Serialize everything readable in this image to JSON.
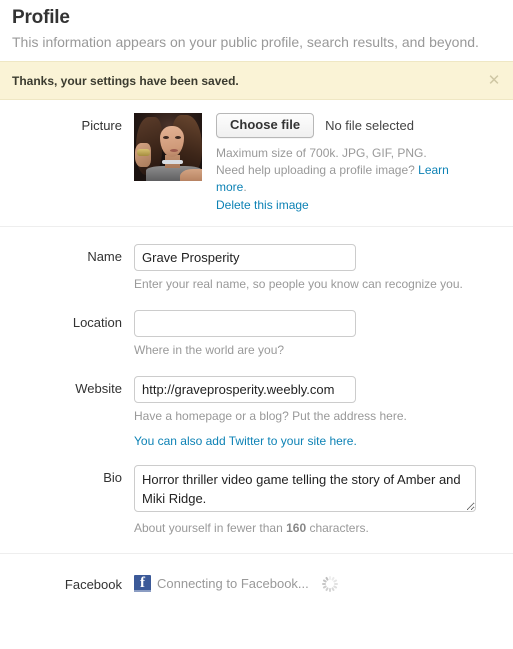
{
  "header": {
    "title": "Profile",
    "subtitle": "This information appears on your public profile, search results, and beyond."
  },
  "flash": {
    "message": "Thanks, your settings have been saved.",
    "close_icon": "close-icon",
    "close_glyph": "✕",
    "bg_color": "#faf3d6",
    "border_color": "#efe7c4",
    "text_color": "#3b3b2f"
  },
  "colors": {
    "link": "#0d82b5",
    "hint": "#999999",
    "label": "#333333",
    "facebook_blue": "#3b5998",
    "input_border": "#cccccc",
    "divider": "#eeeeee"
  },
  "fields": {
    "picture": {
      "label": "Picture",
      "avatar_name": "profile-avatar-image",
      "choose_file_label": "Choose file",
      "file_status": "No file selected",
      "hint_size": "Maximum size of 700k. JPG, GIF, PNG.",
      "hint_help_prefix": "Need help uploading a profile image? ",
      "hint_help_link": "Learn more",
      "hint_help_suffix": ".",
      "delete_link": "Delete this image"
    },
    "name": {
      "label": "Name",
      "value": "Grave Prosperity",
      "placeholder": "",
      "hint": "Enter your real name, so people you know can recognize you."
    },
    "location": {
      "label": "Location",
      "value": "",
      "placeholder": "",
      "hint": "Where in the world are you?"
    },
    "website": {
      "label": "Website",
      "value": "http://graveprosperity.weebly.com",
      "placeholder": "",
      "hint": "Have a homepage or a blog? Put the address here.",
      "twitter_link": "You can also add Twitter to your site here."
    },
    "bio": {
      "label": "Bio",
      "value": "Horror thriller video game telling the story of Amber and Miki Ridge.",
      "placeholder": "",
      "hint_prefix": "About yourself in fewer than ",
      "hint_count": "160",
      "hint_suffix": " characters."
    },
    "facebook": {
      "label": "Facebook",
      "icon": "facebook-icon",
      "status": "Connecting to Facebook...",
      "spinner": "loading-spinner-icon"
    }
  }
}
